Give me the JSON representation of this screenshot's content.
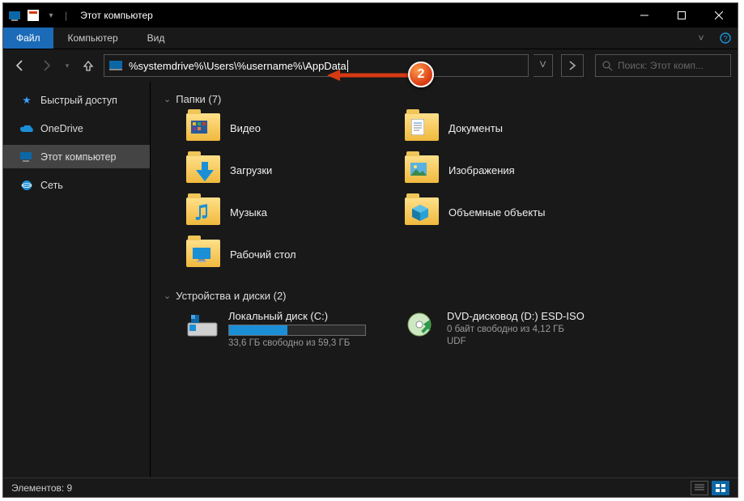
{
  "window": {
    "title": "Этот компьютер"
  },
  "menu": {
    "file": "Файл",
    "computer": "Компьютер",
    "view": "Вид"
  },
  "address": {
    "path": "%systemdrive%\\Users\\%username%\\AppData"
  },
  "search": {
    "placeholder": "Поиск: Этот комп..."
  },
  "sidebar": {
    "items": [
      {
        "label": "Быстрый доступ",
        "icon": "star-icon"
      },
      {
        "label": "OneDrive",
        "icon": "cloud-icon"
      },
      {
        "label": "Этот компьютер",
        "icon": "pc-icon",
        "selected": true
      },
      {
        "label": "Сеть",
        "icon": "network-icon"
      }
    ]
  },
  "groups": {
    "folders": {
      "header": "Папки (7)"
    },
    "drives": {
      "header": "Устройства и диски (2)"
    }
  },
  "folders": [
    {
      "label": "Видео"
    },
    {
      "label": "Документы"
    },
    {
      "label": "Загрузки"
    },
    {
      "label": "Изображения"
    },
    {
      "label": "Музыка"
    },
    {
      "label": "Объемные объекты"
    },
    {
      "label": "Рабочий стол"
    }
  ],
  "drives": [
    {
      "name": "Локальный диск (C:)",
      "free_text": "33,6 ГБ свободно из 59,3 ГБ",
      "fill_pct": 43
    },
    {
      "name": "DVD-дисковод (D:) ESD-ISO",
      "free_text": "0 байт свободно из 4,12 ГБ",
      "fs": "UDF"
    }
  ],
  "status": {
    "count_label": "Элементов: 9"
  },
  "annotation": {
    "badge": "2"
  }
}
